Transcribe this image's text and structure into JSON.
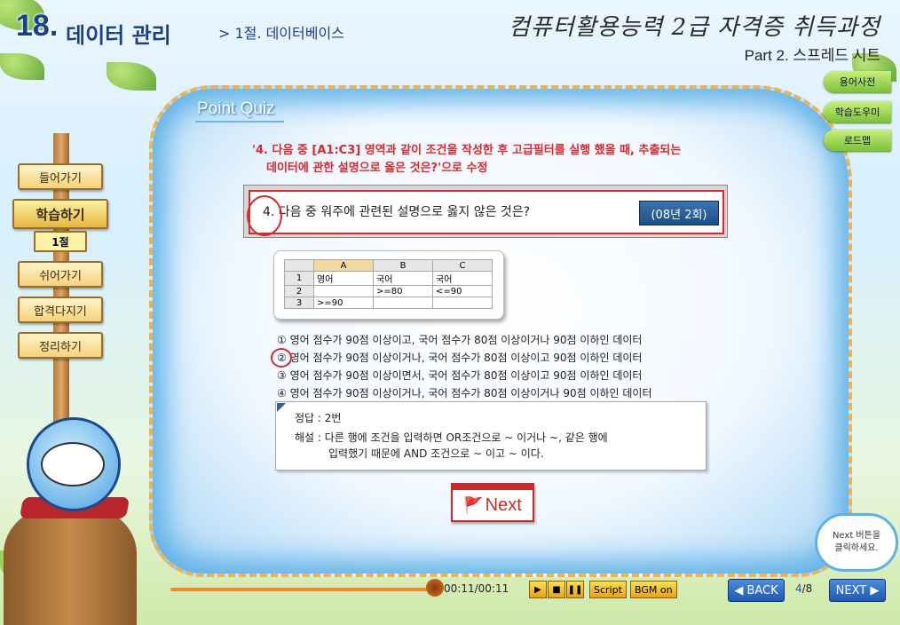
{
  "header": {
    "chapter_num": "18.",
    "chapter_title": "데이터 관리",
    "section": "> 1절.  데이터베이스",
    "course_title": "컴퓨터활용능력 2급 자격증 취득과정",
    "part_label": "Part 2. 스프레드 시트"
  },
  "board": {
    "title": "Point Quiz"
  },
  "right_tabs": [
    "용어사전",
    "학습도우미",
    "로드맵"
  ],
  "left_nav": {
    "items": [
      "들어가기",
      "학습하기",
      "쉬어가기",
      "합격다지기",
      "정리하기"
    ],
    "active_sub": "1절"
  },
  "note": {
    "line1": "'4. 다음 중 [A1:C3] 영역과 같이 조건을 작성한 후 고급필터를 실행 했을 때, 추출되는",
    "line2": "데이터에 관한 설명으로 옳은 것은?'으로 수정"
  },
  "question": {
    "text": "4. 다음 중 워주에 관련된 설명으로 옳지 않은 것은?",
    "badge": "(08년 2회)"
  },
  "sheet": {
    "columns": [
      "A",
      "B",
      "C"
    ],
    "rows": [
      {
        "num": "1",
        "cells": [
          "영어",
          "국어",
          "국어"
        ]
      },
      {
        "num": "2",
        "cells": [
          "",
          ">=80",
          "<=90"
        ]
      },
      {
        "num": "3",
        "cells": [
          ">=90",
          "",
          ""
        ]
      }
    ]
  },
  "options": [
    "① 영어 점수가 90점 이상이고, 국어 점수가 80점 이상이거나 90점 이하인 데이터",
    "② 영어 점수가 90점 이상이거나, 국어 점수가 80점 이상이고 90점 이하인 데이터",
    "③ 영어 점수가 90점 이상이면서, 국어 점수가 80점 이상이고 90점 이하인 데이터",
    "④ 영어 점수가 90점 이상이거나, 국어 점수가 80점 이상이거나 90점 이하인 데이터"
  ],
  "answer": {
    "label": "정답 : 2번",
    "expl1": "해설 : 다른 행에 조건을 입력하면 OR조건으로 ~ 이거나 ~, 같은 행에",
    "expl2": "입력했기 때문에 AND 조건으로 ~ 이고 ~ 이다."
  },
  "next_label": "Next",
  "bubble": {
    "line1": "Next 버튼을",
    "line2": "클릭하세요."
  },
  "player": {
    "time": "00:11/00:11",
    "progress": 1.0,
    "script_label": "Script",
    "bgm_label": "BGM on",
    "back_label": "◀ BACK",
    "next_label": "NEXT ▶",
    "page_current": "4",
    "page_total": "/8"
  },
  "colors": {
    "accent_red": "#e0262a",
    "nav_blue": "#1f58b0",
    "title_blue": "#1a3f8c"
  }
}
